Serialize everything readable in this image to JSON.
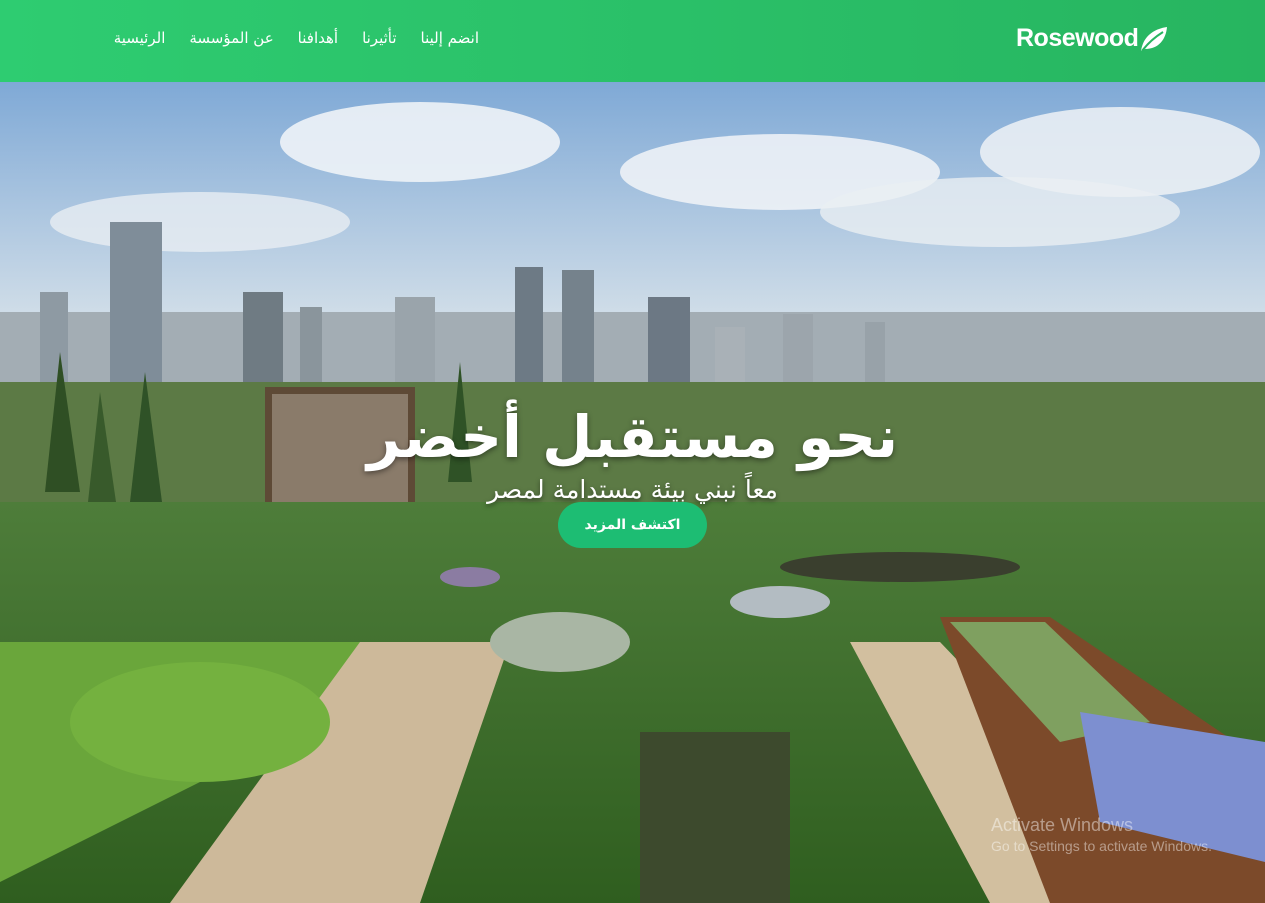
{
  "brand": {
    "name": "Rosewood",
    "icon": "leaf-icon"
  },
  "nav": {
    "items": [
      {
        "label": "الرئيسية"
      },
      {
        "label": "عن المؤسسة"
      },
      {
        "label": "أهدافنا"
      },
      {
        "label": "تأثيرنا"
      },
      {
        "label": "انضم إلينا"
      }
    ]
  },
  "hero": {
    "title": "نحو مستقبل أخضر",
    "subtitle": "معاً نبني بيئة مستدامة لمصر",
    "cta_label": "اكتشف المزيد"
  },
  "watermark": {
    "title": "Activate Windows",
    "subtitle": "Go to Settings to activate Windows."
  },
  "colors": {
    "nav_bg": "#2ecc71",
    "cta_bg": "#1dbd73",
    "text": "#ffffff"
  }
}
